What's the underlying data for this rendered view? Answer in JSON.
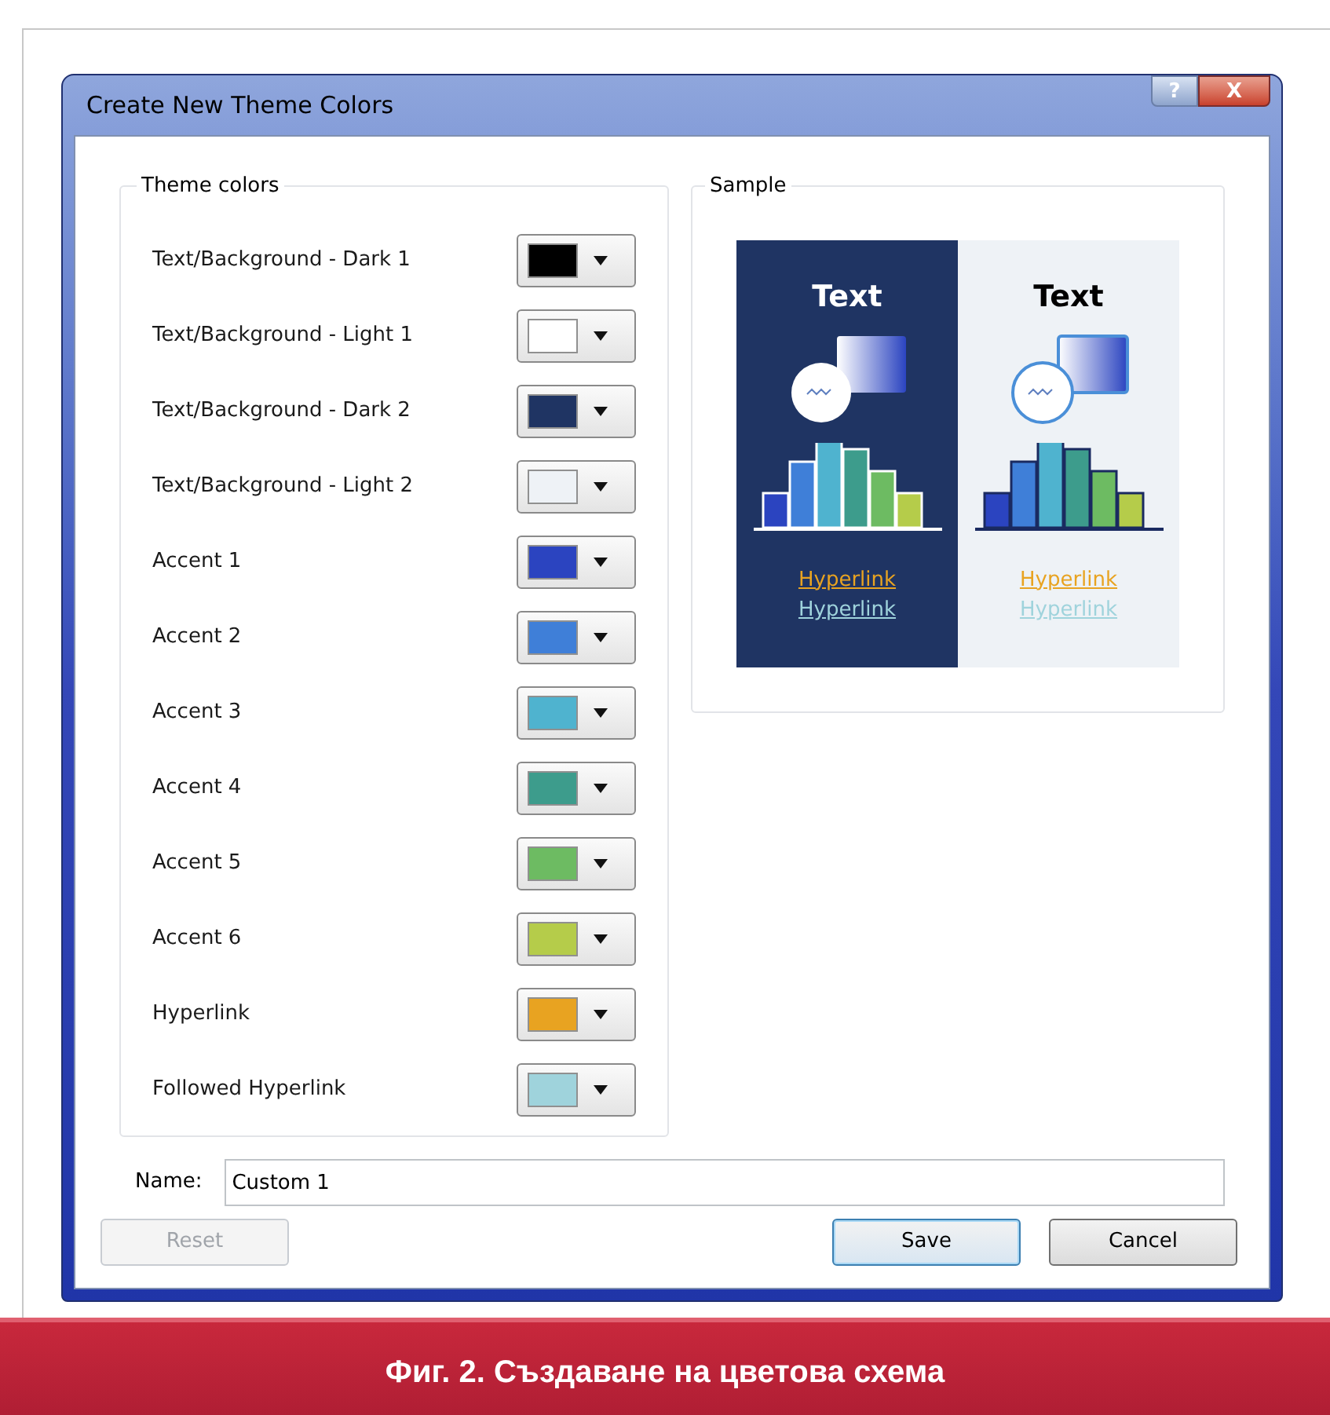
{
  "window": {
    "title": "Create New Theme Colors",
    "help_glyph": "?",
    "close_glyph": "X"
  },
  "theme_colors": {
    "title": "Theme colors",
    "items": [
      {
        "label": "Text/Background - Dark 1",
        "color": "#000000"
      },
      {
        "label": "Text/Background - Light 1",
        "color": "#ffffff"
      },
      {
        "label": "Text/Background - Dark 2",
        "color": "#1f3463"
      },
      {
        "label": "Text/Background - Light 2",
        "color": "#eef2f6"
      },
      {
        "label": "Accent 1",
        "color": "#2b44c0"
      },
      {
        "label": "Accent 2",
        "color": "#3f7fd8"
      },
      {
        "label": "Accent 3",
        "color": "#4fb3cf"
      },
      {
        "label": "Accent 4",
        "color": "#3d9c8c"
      },
      {
        "label": "Accent 5",
        "color": "#6dbb62"
      },
      {
        "label": "Accent 6",
        "color": "#b5cc4a"
      },
      {
        "label": "Hyperlink",
        "color": "#e8a321"
      },
      {
        "label": "Followed Hyperlink",
        "color": "#9fd3dc"
      }
    ]
  },
  "sample": {
    "title": "Sample",
    "panels": [
      {
        "kind": "dark",
        "heading": "Text",
        "hyperlink": "Hyperlink",
        "followed_hyperlink": "Hyperlink"
      },
      {
        "kind": "light",
        "heading": "Text",
        "hyperlink": "Hyperlink",
        "followed_hyperlink": "Hyperlink"
      }
    ]
  },
  "name": {
    "label": "Name:",
    "value": "Custom 1"
  },
  "buttons": [
    {
      "label": "Reset",
      "disabled": true,
      "default": false
    },
    {
      "label": "Save",
      "disabled": false,
      "default": true
    },
    {
      "label": "Cancel",
      "disabled": false,
      "default": false
    }
  ],
  "caption": "Фиг. 2. Създаване на цветова схема"
}
